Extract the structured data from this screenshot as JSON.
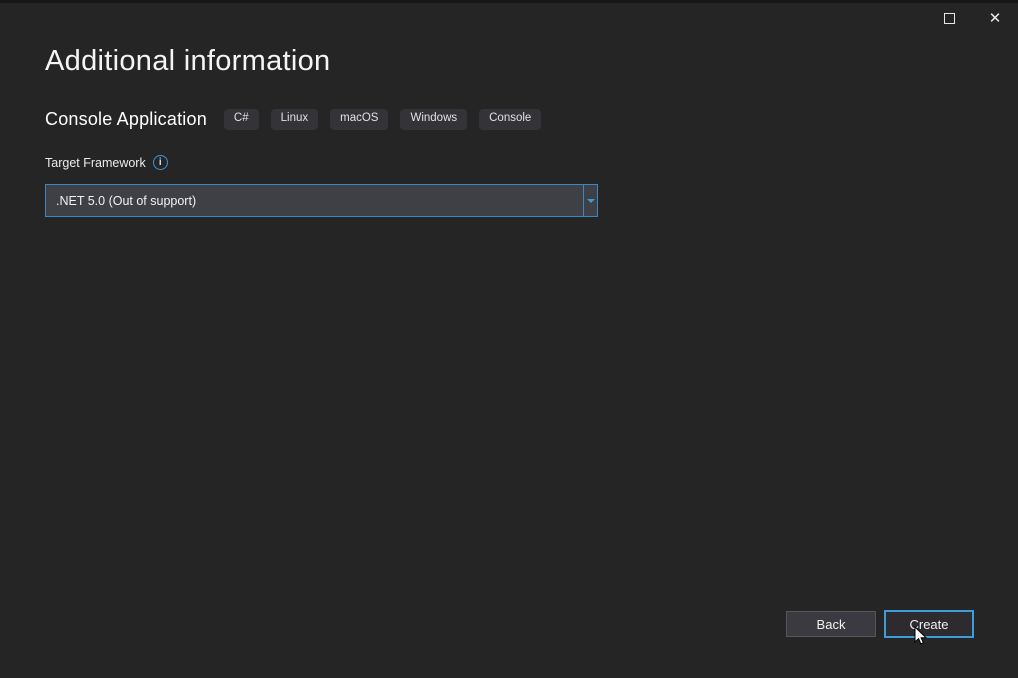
{
  "window": {
    "controls": [
      {
        "name": "maximize"
      },
      {
        "name": "close",
        "glyph": "✕"
      }
    ]
  },
  "header": {
    "title": "Additional information"
  },
  "project": {
    "name": "Console Application",
    "tags": [
      "C#",
      "Linux",
      "macOS",
      "Windows",
      "Console"
    ]
  },
  "form": {
    "target_framework": {
      "label": "Target Framework",
      "info_icon": "i",
      "value": ".NET 5.0 (Out of support)"
    }
  },
  "footer": {
    "back_label": "Back",
    "create_label": "Create"
  },
  "colors": {
    "background": "#252526",
    "accent_blue": "#3e9bd5",
    "combo_border": "#3c86c4"
  }
}
